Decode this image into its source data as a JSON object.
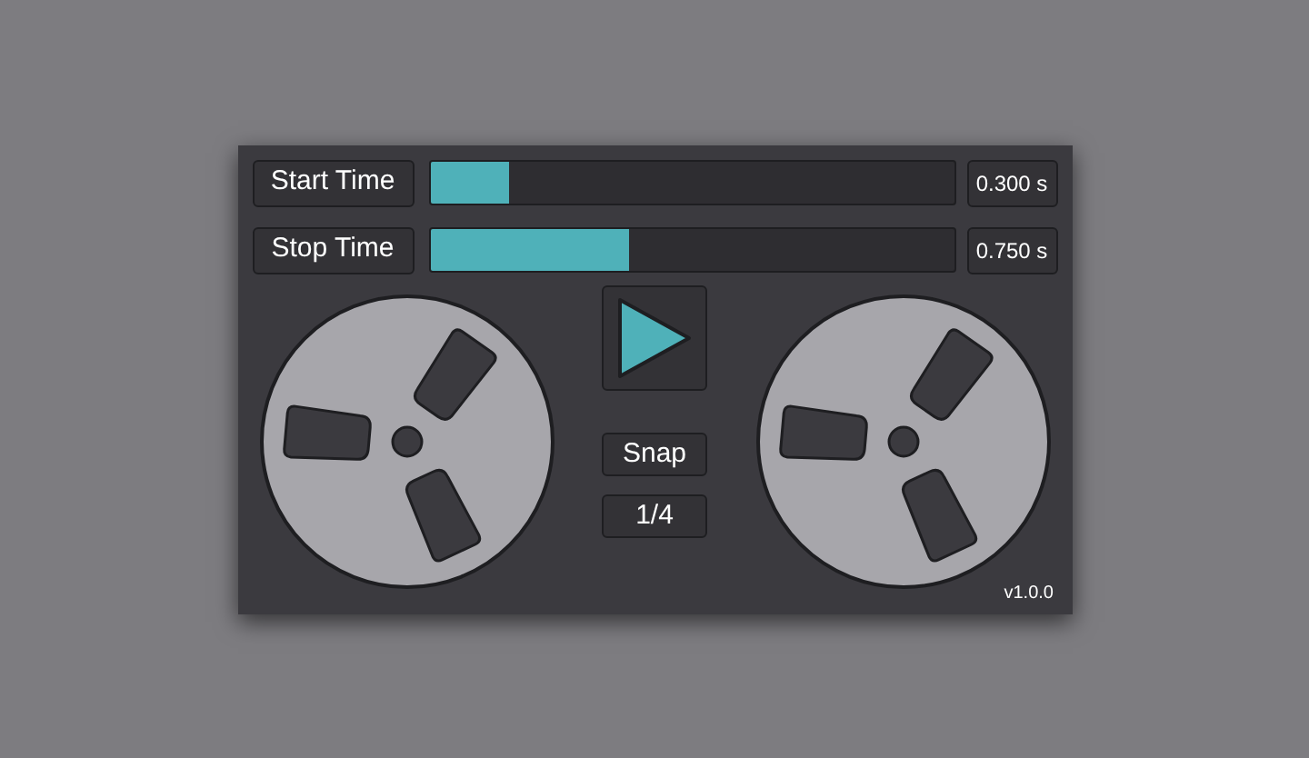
{
  "sliders": [
    {
      "label": "Start Time",
      "level": 0.15,
      "reading": "0.300 s"
    },
    {
      "label": "Stop Time",
      "level": 0.38,
      "reading": "0.750 s"
    }
  ],
  "snap_button": {
    "label": "Snap"
  },
  "snap_value": {
    "label": "1/4"
  },
  "version": "v1.0.0"
}
